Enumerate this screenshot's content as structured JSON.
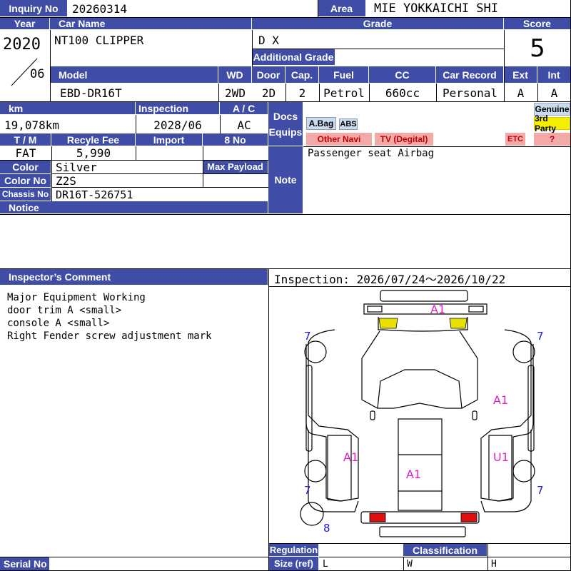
{
  "header": {
    "inquiry_label": "Inquiry No",
    "inquiry_no": "20260314",
    "area_label": "Area",
    "area": "MIE YOKKAICHI SHI",
    "year_label": "Year",
    "year": "2020",
    "month": "06",
    "car_name_label": "Car Name",
    "car_name": "NT100 CLIPPER",
    "grade_label": "Grade",
    "grade": "D X",
    "additional_grade_label": "Additional Grade",
    "score_label": "Score",
    "score": "5"
  },
  "specs": {
    "model_label": "Model",
    "model": "EBD-DR16T",
    "wd_label": "WD",
    "wd": "2WD",
    "door_label": "Door",
    "door": "2D",
    "cap_label": "Cap.",
    "cap": "2",
    "fuel_label": "Fuel",
    "fuel": "Petrol",
    "cc_label": "CC",
    "cc": "660cc",
    "record_label": "Car Record",
    "record": "Personal",
    "ext_label": "Ext",
    "ext": "A",
    "int_label": "Int",
    "int": "A"
  },
  "details": {
    "km_label": "km",
    "km": "19,078km",
    "inspection_label": "Inspection",
    "inspection": "2028/06",
    "ac_label": "A / C",
    "ac": "AC",
    "docs_label": "Docs",
    "equips_label": "Equips",
    "tm_label": "T / M",
    "tm": "FAT",
    "recycle_label": "Recyle Fee",
    "recycle": "5,990",
    "import_label": "Import",
    "no8_label": "8 No",
    "color_label": "Color",
    "color": "Silver",
    "payload_label": "Max Payload",
    "color_no_label": "Color No",
    "color_no": "Z2S",
    "chassis_label": "Chassis No",
    "chassis": "DR16T-526751",
    "notice_label": "Notice",
    "note_label": "Note",
    "note": "Passenger seat Airbag"
  },
  "equips": {
    "abag": "A.Bag",
    "abs": "ABS",
    "genuine": "Genuine",
    "third_party": "3rd Party",
    "other_navi": "Other Navi",
    "tv": "TV (Degital)",
    "etc": "ETC",
    "question": "?"
  },
  "comment": {
    "label": "Inspector’s Comment",
    "lines": [
      "Major Equipment Working",
      "door trim A <small>",
      "console A <small>",
      "Right Fender screw adjustment mark"
    ]
  },
  "inspection_period": "Inspection: 2026/07/24〜2026/10/22",
  "diagram": {
    "marks": {
      "front": "A1",
      "right_side": "A1",
      "left_rear": "A1",
      "right_rear": "U1",
      "bed": "A1"
    },
    "tires": {
      "fl": "7",
      "fr": "7",
      "rl": "7",
      "rr": "7",
      "spare": "8"
    },
    "colors": {
      "mark": "#e020c0",
      "tire": "#1a1adf",
      "light_yellow": "#e8e000",
      "light_red": "#e01010"
    }
  },
  "footer": {
    "regulation_label": "Regulation",
    "classification_label": "Classification",
    "size_label": "Size (ref)",
    "serial_label": "Serial No",
    "l": "L",
    "w": "W",
    "h": "H"
  },
  "colors": {
    "header": "#3f4da6",
    "accent_red": "#f4a9a9",
    "accent_yellow": "#f6f000",
    "accent_blue": "#c8dcf0"
  }
}
